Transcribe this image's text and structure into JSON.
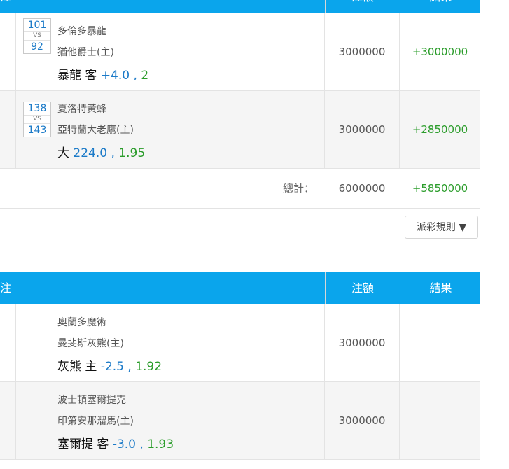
{
  "table1": {
    "header": {
      "bet": "注",
      "amount": "注額",
      "result": "結果"
    },
    "rows": [
      {
        "num_top": "101",
        "vs": "VS",
        "num_bottom": "92",
        "team1": "多倫多暴龍",
        "team2": "猶他爵士(主)",
        "pick": "暴龍 客",
        "line": "+4.0",
        "sep": " , ",
        "odds": "2",
        "amount": "3000000",
        "result": "+3000000"
      },
      {
        "num_top": "138",
        "vs": "VS",
        "num_bottom": "143",
        "team1": "夏洛特黃蜂",
        "team2": "亞特蘭大老鷹(主)",
        "pick": "大",
        "line": "224.0",
        "sep": " , ",
        "odds": "1.95",
        "amount": "3000000",
        "result": "+2850000"
      }
    ],
    "total": {
      "label": "總計：",
      "amount": "6000000",
      "result": "+5850000"
    }
  },
  "rules_button": {
    "label": "派彩規則 ▼"
  },
  "table2": {
    "header": {
      "bet": "投注",
      "amount": "注額",
      "result": "結果"
    },
    "rows": [
      {
        "team1": "奧蘭多魔術",
        "team2": "曼斐斯灰熊(主)",
        "pick": "灰熊 主",
        "line": "-2.5",
        "sep": " , ",
        "odds": "1.92",
        "amount": "3000000",
        "result": ""
      },
      {
        "team1": "波士頓塞爾提克",
        "team2": "印第安那溜馬(主)",
        "pick": "塞爾提 客",
        "line": "-3.0",
        "sep": " , ",
        "odds": "1.93",
        "amount": "3000000",
        "result": ""
      }
    ]
  }
}
